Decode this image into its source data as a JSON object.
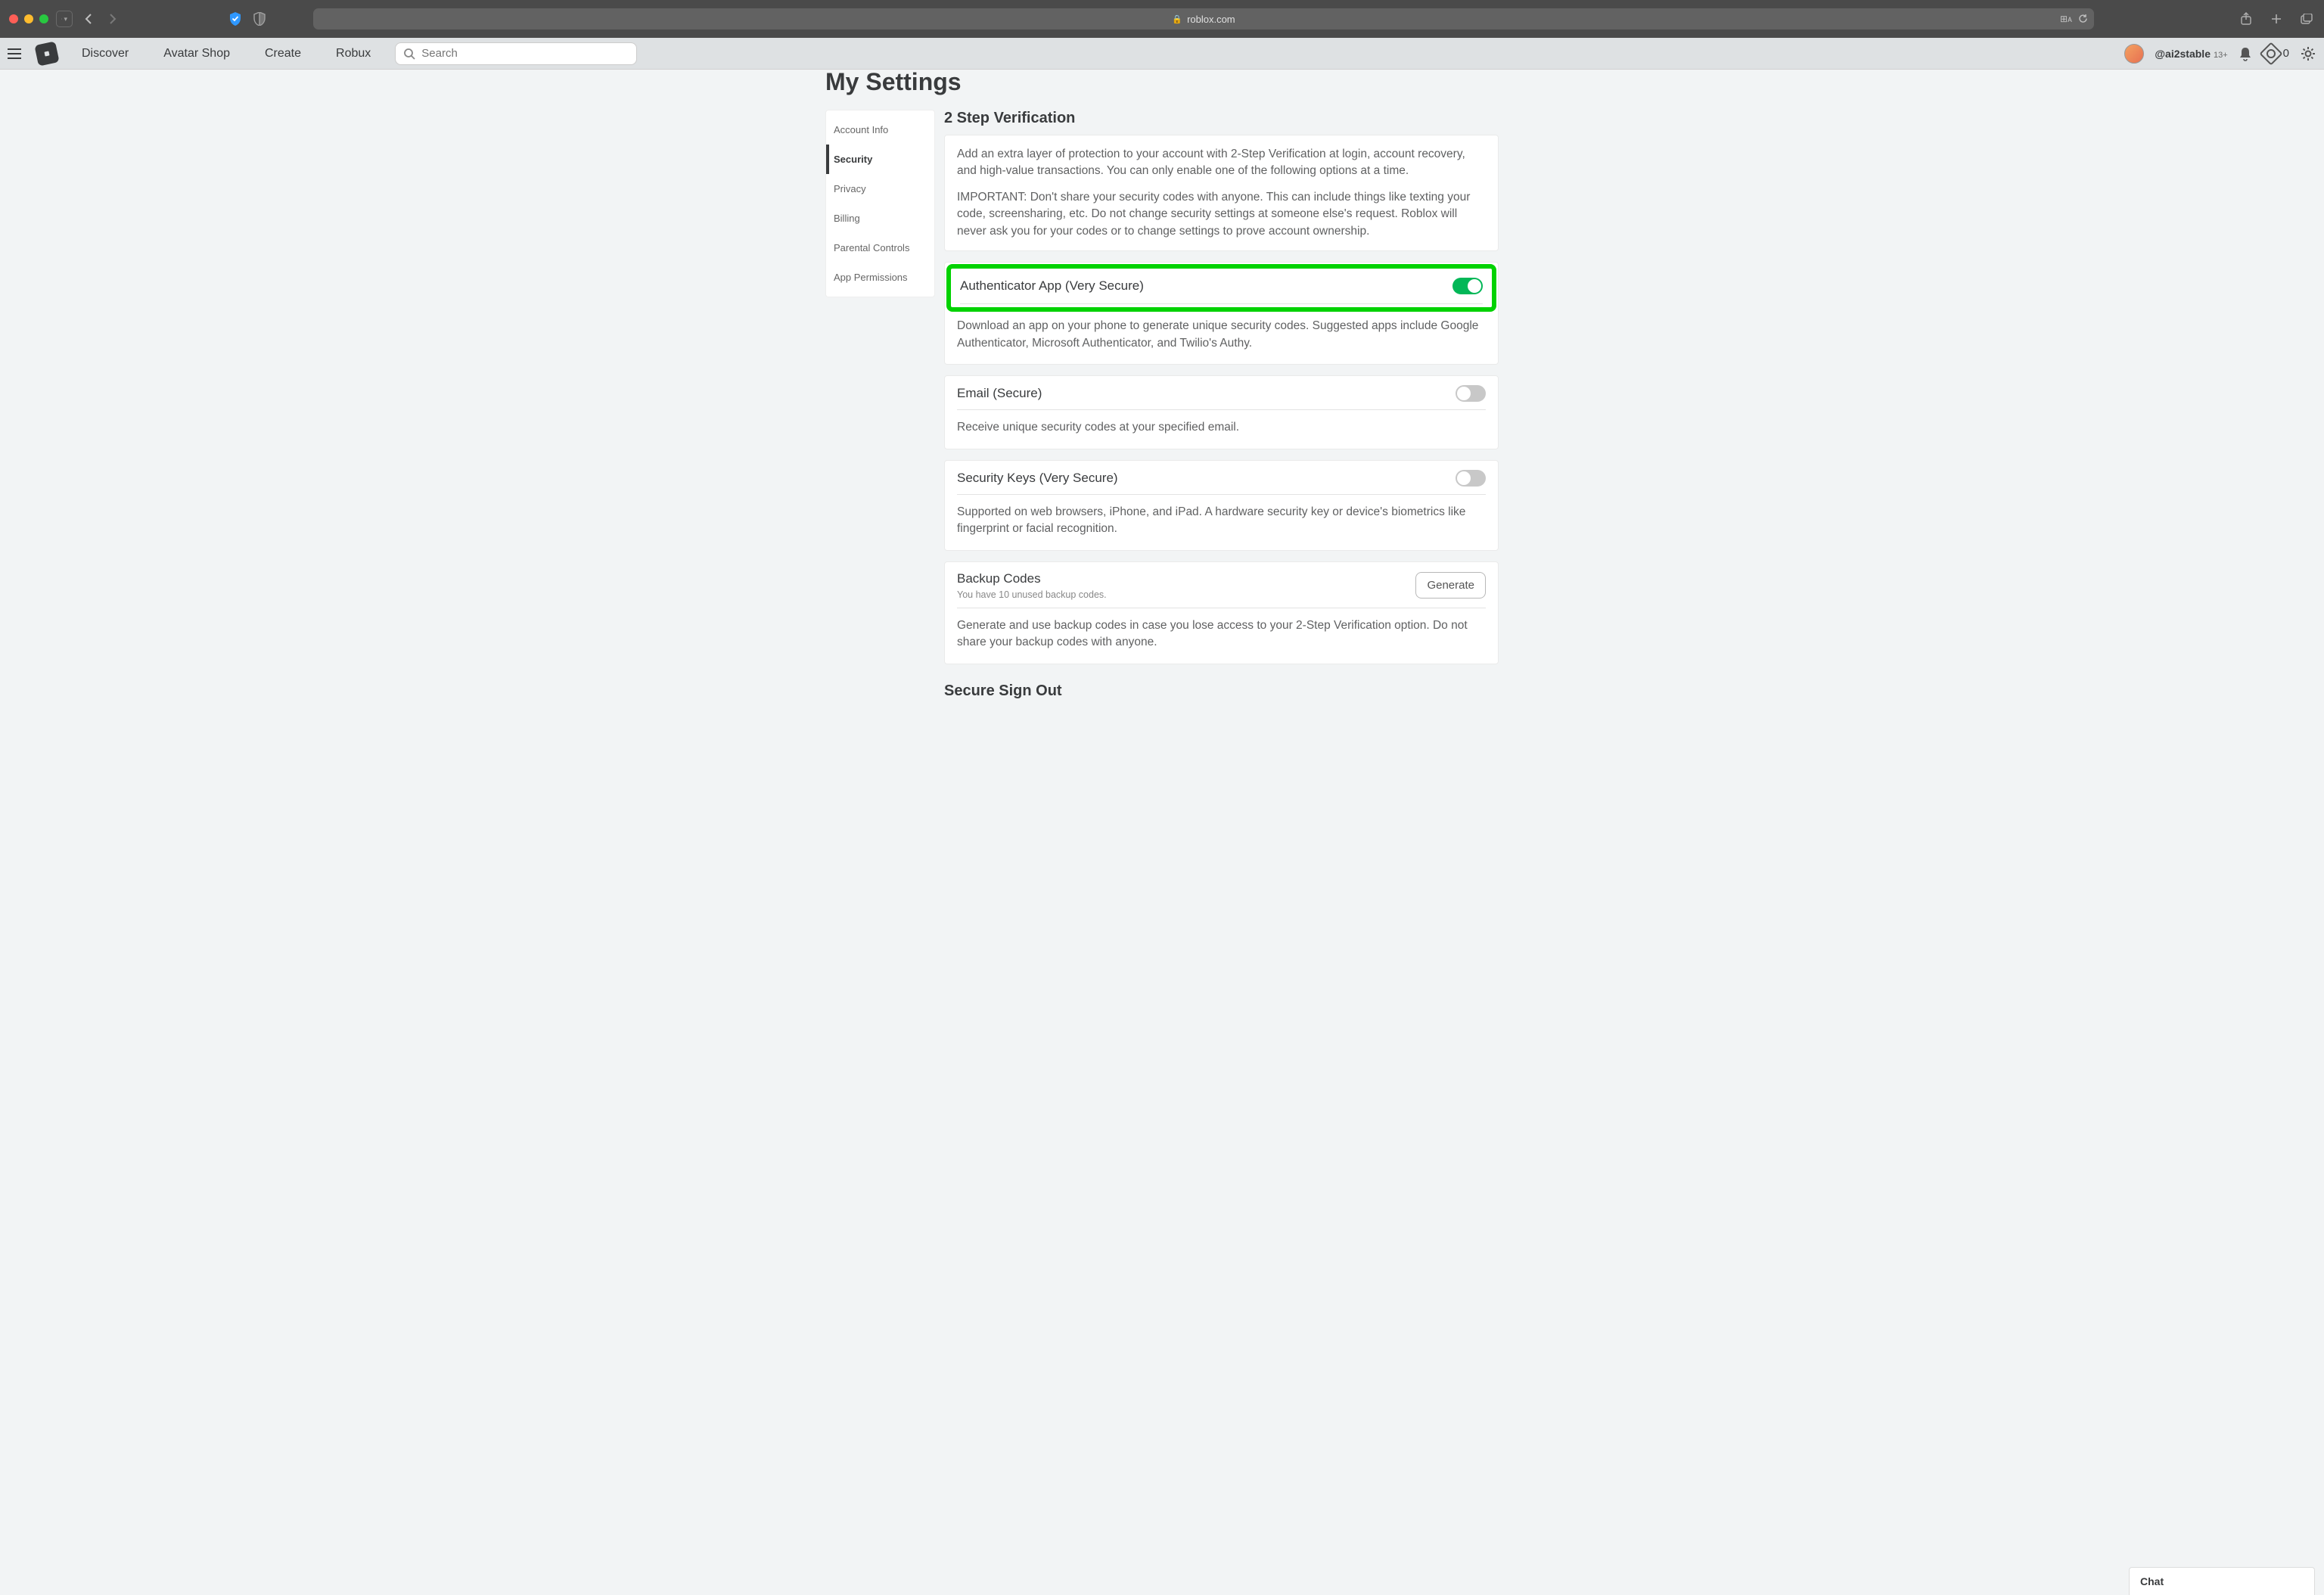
{
  "browser": {
    "url_host": "roblox.com"
  },
  "nav": {
    "links": [
      "Discover",
      "Avatar Shop",
      "Create",
      "Robux"
    ],
    "search_placeholder": "Search",
    "username": "@ai2stable",
    "age_badge": "13+",
    "robux_count": "0"
  },
  "page": {
    "title": "My Settings"
  },
  "sidebar": {
    "items": [
      "Account Info",
      "Security",
      "Privacy",
      "Billing",
      "Parental Controls",
      "App Permissions"
    ],
    "active_index": 1
  },
  "section": {
    "heading": "2 Step Verification",
    "intro_p1": "Add an extra layer of protection to your account with 2-Step Verification at login, account recovery, and high-value transactions. You can only enable one of the following options at a time.",
    "intro_p2": "IMPORTANT: Don't share your security codes with anyone. This can include things like texting your code, screensharing, etc. Do not change security settings at someone else's request. Roblox will never ask you for your codes or to change settings to prove account ownership.",
    "auth_app": {
      "title": "Authenticator App (Very Secure)",
      "body": "Download an app on your phone to generate unique security codes. Suggested apps include Google Authenticator, Microsoft Authenticator, and Twilio's Authy.",
      "enabled": true
    },
    "email": {
      "title": "Email (Secure)",
      "body": "Receive unique security codes at your specified email.",
      "enabled": false
    },
    "security_keys": {
      "title": "Security Keys (Very Secure)",
      "body": "Supported on web browsers, iPhone, and iPad. A hardware security key or device's biometrics like fingerprint or facial recognition.",
      "enabled": false
    },
    "backup": {
      "title": "Backup Codes",
      "subtitle": "You have 10 unused backup codes.",
      "generate_label": "Generate",
      "body": "Generate and use backup codes in case you lose access to your 2-Step Verification option. Do not share your backup codes with anyone."
    },
    "secure_signout_heading": "Secure Sign Out"
  },
  "chat": {
    "label": "Chat"
  }
}
